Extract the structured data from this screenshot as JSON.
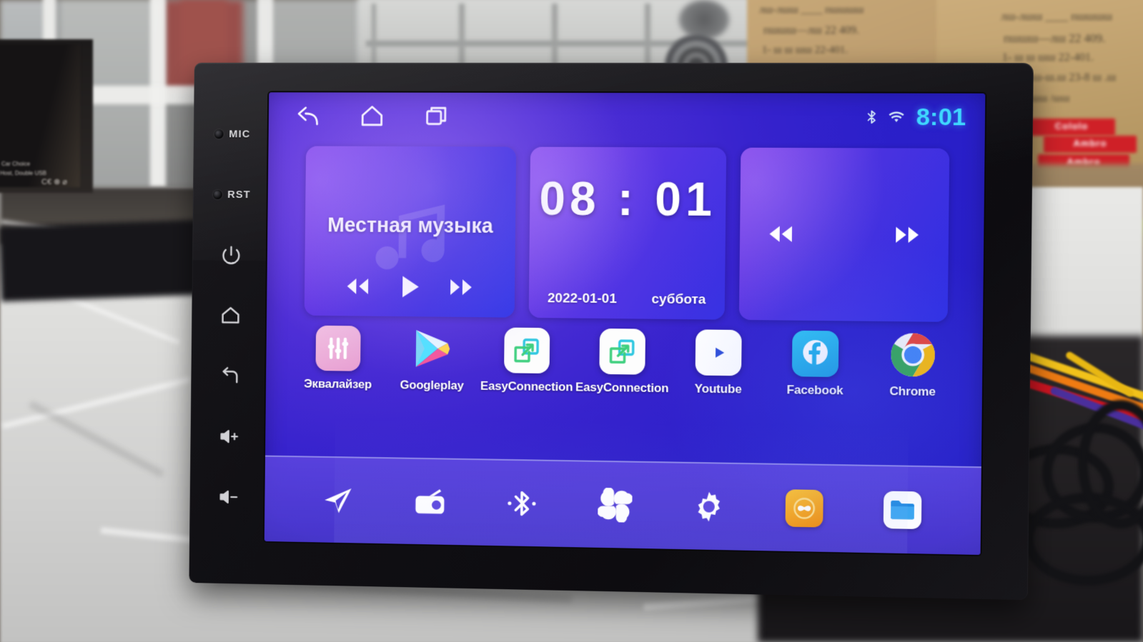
{
  "device": {
    "bezel_items": [
      {
        "name": "mic",
        "type": "pinhole-label",
        "label": "MIC"
      },
      {
        "name": "reset",
        "type": "pinhole-label",
        "label": "RST"
      },
      {
        "name": "power",
        "type": "icon",
        "icon": "power-icon",
        "label": "Power"
      },
      {
        "name": "home",
        "type": "icon",
        "icon": "home-icon",
        "label": "Home"
      },
      {
        "name": "back",
        "type": "icon",
        "icon": "back-icon",
        "label": "Back"
      },
      {
        "name": "vol-up",
        "type": "icon",
        "icon": "volume-up-icon",
        "label": "Volume Up"
      },
      {
        "name": "vol-down",
        "type": "icon",
        "icon": "volume-down-icon",
        "label": "Volume Down"
      }
    ]
  },
  "statusbar": {
    "nav": [
      {
        "name": "back-icon",
        "label": "Back"
      },
      {
        "name": "home-icon",
        "label": "Home"
      },
      {
        "name": "recents-icon",
        "label": "Recent apps"
      }
    ],
    "bluetooth_icon": "bluetooth-icon",
    "wifi_icon": "wifi-icon",
    "time": "8:01",
    "time_color": "#3fd8ff"
  },
  "widgets": {
    "music": {
      "title": "Местная музыка",
      "controls": [
        {
          "name": "prev-button",
          "label": "Previous"
        },
        {
          "name": "play-button",
          "label": "Play"
        },
        {
          "name": "next-button",
          "label": "Next"
        }
      ]
    },
    "clock": {
      "time": "08 : 01",
      "date": "2022-01-01",
      "weekday": "суббота"
    },
    "radio": {
      "controls": [
        {
          "name": "prev-button",
          "label": "Previous station"
        },
        {
          "name": "next-button",
          "label": "Next station"
        }
      ]
    }
  },
  "apps": [
    {
      "label": "Эквалайзер",
      "icon": "equalizer-icon",
      "bg": "#eaa8d6"
    },
    {
      "label": "Googleplay",
      "icon": "google-play-icon",
      "bg": "transparent"
    },
    {
      "label": "EasyConnection",
      "icon": "easyconnection-icon",
      "bg": "#fdfdfd"
    },
    {
      "label": "EasyConnection",
      "icon": "easyconnection-icon",
      "bg": "#fdfdfd"
    },
    {
      "label": "Youtube",
      "icon": "youtube-icon",
      "bg": "#ffffff"
    },
    {
      "label": "Facebook",
      "icon": "facebook-icon",
      "bg": "#23b0e8"
    },
    {
      "label": "Chrome",
      "icon": "chrome-icon",
      "bg": "transparent"
    }
  ],
  "dock": [
    {
      "name": "navigation-icon",
      "label": "Navigation"
    },
    {
      "name": "radio-icon",
      "label": "Radio"
    },
    {
      "name": "bluetooth-icon",
      "label": "Bluetooth"
    },
    {
      "name": "apps-grid-icon",
      "label": "All apps"
    },
    {
      "name": "settings-gear-icon",
      "label": "Settings"
    },
    {
      "name": "link-app-icon",
      "label": "Link",
      "bg": "#f7a41b"
    },
    {
      "name": "file-manager-icon",
      "label": "File manager",
      "bg": "#ffffff"
    }
  ],
  "background": {
    "box_labels": [
      "Cololo",
      "Ambro",
      "Ambro"
    ],
    "handwriting_lines": [
      "лш-лшш  ____  пшшшш",
      "пшшш—лш   22 409.",
      "1- ш ш  шш    22-401.",
      "шшшш-ш.ш  23-8 ш .ш",
      "лшшшш ____ пшшшшш",
      ". лш шш /шш",
      "ш- ш ш /ш"
    ],
    "darkbox_text": [
      "Car Choice",
      "Host, Double USB",
      "C€ ⊗ ⌀"
    ]
  }
}
